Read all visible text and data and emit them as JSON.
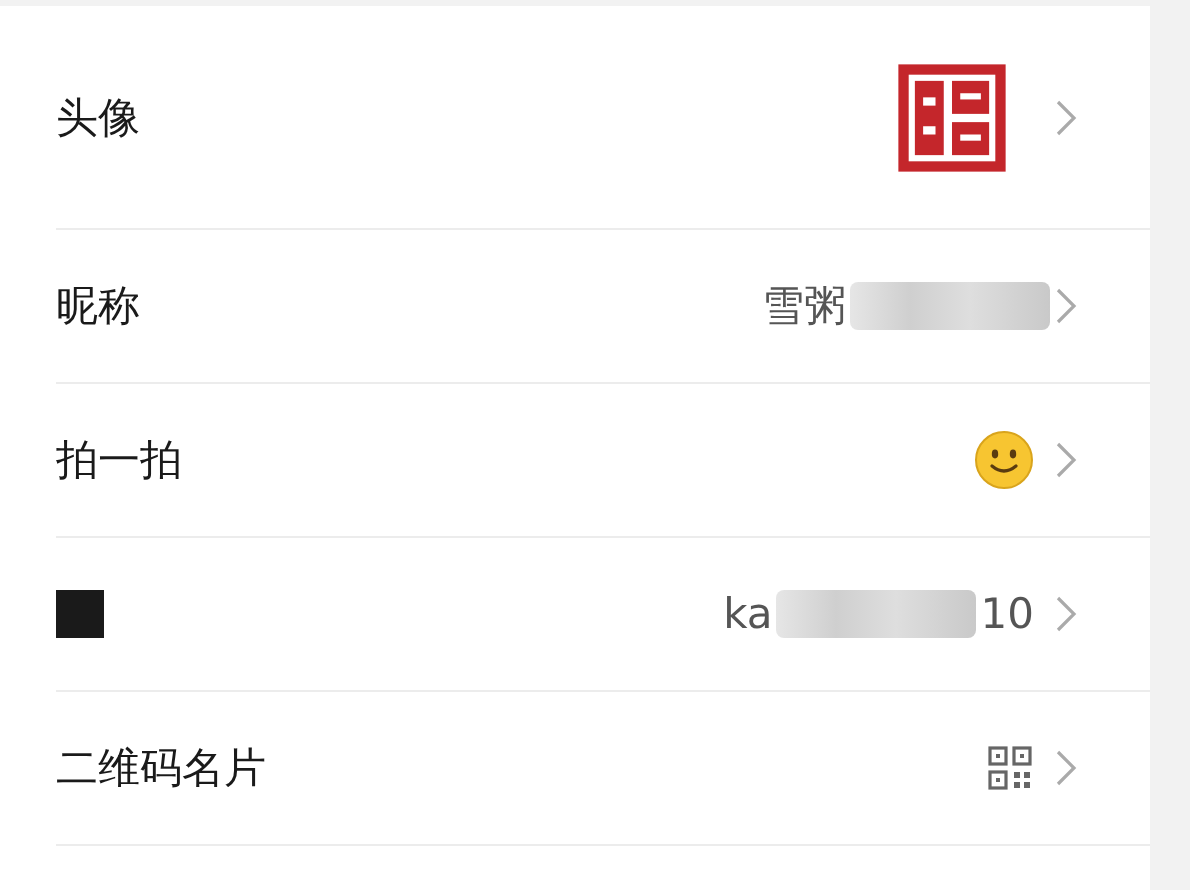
{
  "rows": [
    {
      "kind": "avatar",
      "label": "头像"
    },
    {
      "kind": "text",
      "label": "昵称",
      "value_prefix": "雪粥",
      "blurred": true
    },
    {
      "kind": "emoji",
      "label": "拍一拍"
    },
    {
      "kind": "text",
      "label_redacted": true,
      "value_prefix": "ka",
      "value_suffix": "10",
      "blurred": true
    },
    {
      "kind": "qr",
      "label": "二维码名片"
    }
  ]
}
